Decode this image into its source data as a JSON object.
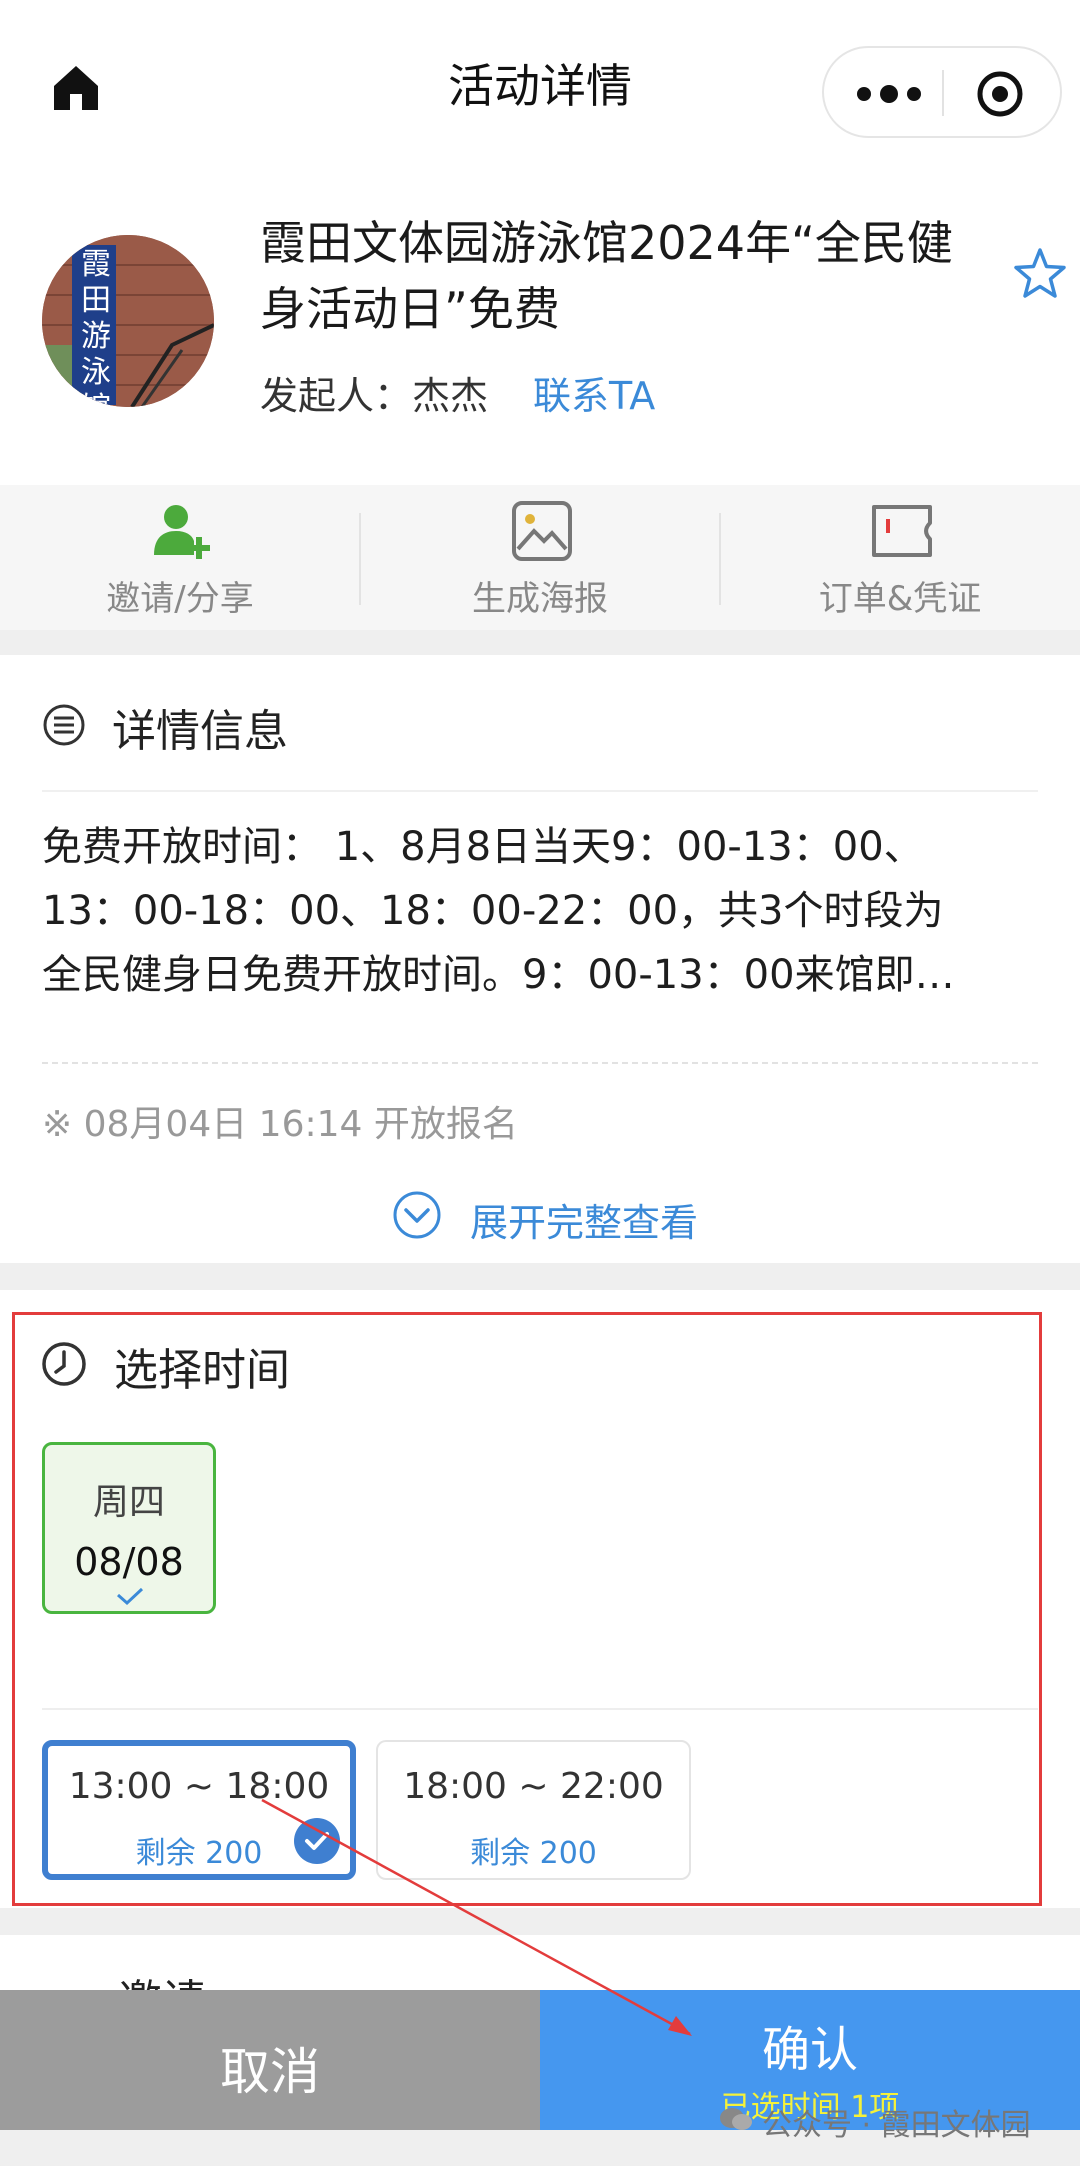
{
  "header": {
    "title": "活动详情"
  },
  "activity": {
    "title": "霞田文体园游泳馆2024年“全民健身活动日”免费",
    "organizer_label": "发起人：杰杰",
    "contact_label": "联系TA",
    "avatar_text": "霞田游泳馆"
  },
  "actions": [
    {
      "label": "邀请/分享",
      "icon": "add-user-icon"
    },
    {
      "label": "生成海报",
      "icon": "image-icon"
    },
    {
      "label": "订单&凭证",
      "icon": "ticket-icon"
    }
  ],
  "details": {
    "title": "详情信息",
    "description": "免费开放时间： 1、8月8日当天9：00-13：00、\n13：00-18：00、18：00-22：00，共3个时段为\n全民健身日免费开放时间。9：00-13：00来馆即…",
    "open_note": "※ 08月04日 16:14 开放报名",
    "expand_label": "展开完整查看"
  },
  "time_select": {
    "title": "选择时间",
    "date": {
      "weekday": "周四",
      "date": "08/08"
    },
    "slots": [
      {
        "time": "13:00 ~ 18:00",
        "remain": "剩余 200",
        "selected": true
      },
      {
        "time": "18:00 ~ 22:00",
        "remain": "剩余 200",
        "selected": false
      }
    ]
  },
  "next_section": {
    "title": "邀请"
  },
  "bottom_bar": {
    "cancel_label": "取消",
    "confirm_label": "确认",
    "confirm_sub": "已选时间 1项"
  },
  "watermark": "公众号 · 霞田文体园",
  "colors": {
    "accent": "#3b8ad8",
    "confirm": "#4597ef",
    "cancel": "#9c9c9c",
    "selected_date": "#49b53f",
    "annotation": "#e33c3c"
  }
}
